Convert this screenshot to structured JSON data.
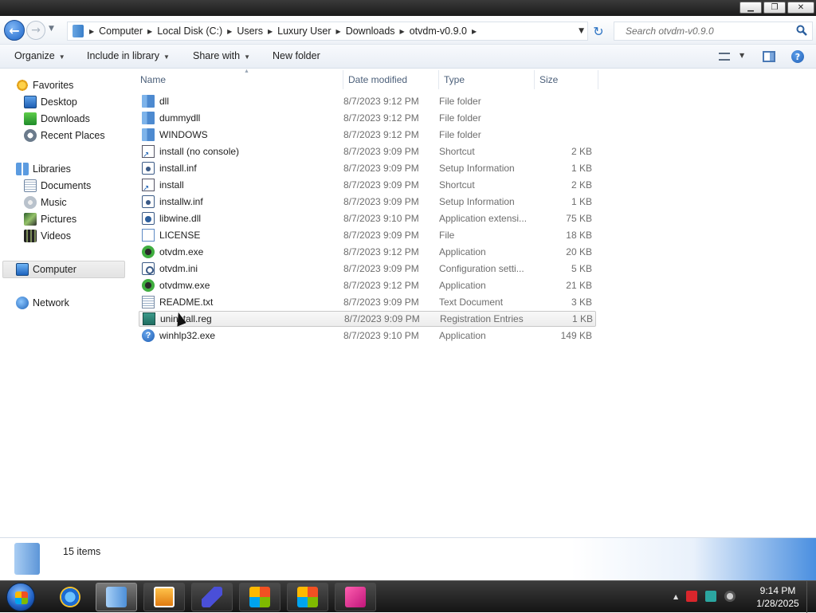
{
  "window": {
    "minimize": "▁",
    "maximize": "❐",
    "close": "✕"
  },
  "address": {
    "crumbs": [
      "Computer",
      "Local Disk (C:)",
      "Users",
      "Luxury User",
      "Downloads",
      "otvdm-v0.9.0"
    ],
    "search_placeholder": "Search otvdm-v0.9.0"
  },
  "toolbar": {
    "organize": "Organize",
    "include_in_library": "Include in library",
    "share_with": "Share with",
    "new_folder": "New folder"
  },
  "nav": {
    "favorites": "Favorites",
    "desktop": "Desktop",
    "downloads": "Downloads",
    "recent_places": "Recent Places",
    "libraries": "Libraries",
    "documents": "Documents",
    "music": "Music",
    "pictures": "Pictures",
    "videos": "Videos",
    "computer": "Computer",
    "network": "Network"
  },
  "columns": {
    "name": "Name",
    "date": "Date modified",
    "type": "Type",
    "size": "Size"
  },
  "files": [
    {
      "name": "dll",
      "date": "8/7/2023 9:12 PM",
      "type": "File folder",
      "size": "",
      "icon": "folder"
    },
    {
      "name": "dummydll",
      "date": "8/7/2023 9:12 PM",
      "type": "File folder",
      "size": "",
      "icon": "folder"
    },
    {
      "name": "WINDOWS",
      "date": "8/7/2023 9:12 PM",
      "type": "File folder",
      "size": "",
      "icon": "folder"
    },
    {
      "name": "install (no console)",
      "date": "8/7/2023 9:09 PM",
      "type": "Shortcut",
      "size": "2 KB",
      "icon": "shortcut"
    },
    {
      "name": "install.inf",
      "date": "8/7/2023 9:09 PM",
      "type": "Setup Information",
      "size": "1 KB",
      "icon": "setup"
    },
    {
      "name": "install",
      "date": "8/7/2023 9:09 PM",
      "type": "Shortcut",
      "size": "2 KB",
      "icon": "shortcut"
    },
    {
      "name": "installw.inf",
      "date": "8/7/2023 9:09 PM",
      "type": "Setup Information",
      "size": "1 KB",
      "icon": "setup"
    },
    {
      "name": "libwine.dll",
      "date": "8/7/2023 9:10 PM",
      "type": "Application extensi...",
      "size": "75 KB",
      "icon": "dll"
    },
    {
      "name": "LICENSE",
      "date": "8/7/2023 9:09 PM",
      "type": "File",
      "size": "18 KB",
      "icon": "file"
    },
    {
      "name": "otvdm.exe",
      "date": "8/7/2023 9:12 PM",
      "type": "Application",
      "size": "20 KB",
      "icon": "app"
    },
    {
      "name": "otvdm.ini",
      "date": "8/7/2023 9:09 PM",
      "type": "Configuration setti...",
      "size": "5 KB",
      "icon": "ini"
    },
    {
      "name": "otvdmw.exe",
      "date": "8/7/2023 9:12 PM",
      "type": "Application",
      "size": "21 KB",
      "icon": "app"
    },
    {
      "name": "README.txt",
      "date": "8/7/2023 9:09 PM",
      "type": "Text Document",
      "size": "3 KB",
      "icon": "txt"
    },
    {
      "name": "uninstall.reg",
      "date": "8/7/2023 9:09 PM",
      "type": "Registration Entries",
      "size": "1 KB",
      "icon": "reg"
    },
    {
      "name": "winhlp32.exe",
      "date": "8/7/2023 9:10 PM",
      "type": "Application",
      "size": "149 KB",
      "icon": "help"
    }
  ],
  "details": {
    "item_count": "15 items"
  },
  "taskbar": {
    "time": "9:14 PM",
    "date": "1/28/2025",
    "tray_arrow": "▲"
  }
}
